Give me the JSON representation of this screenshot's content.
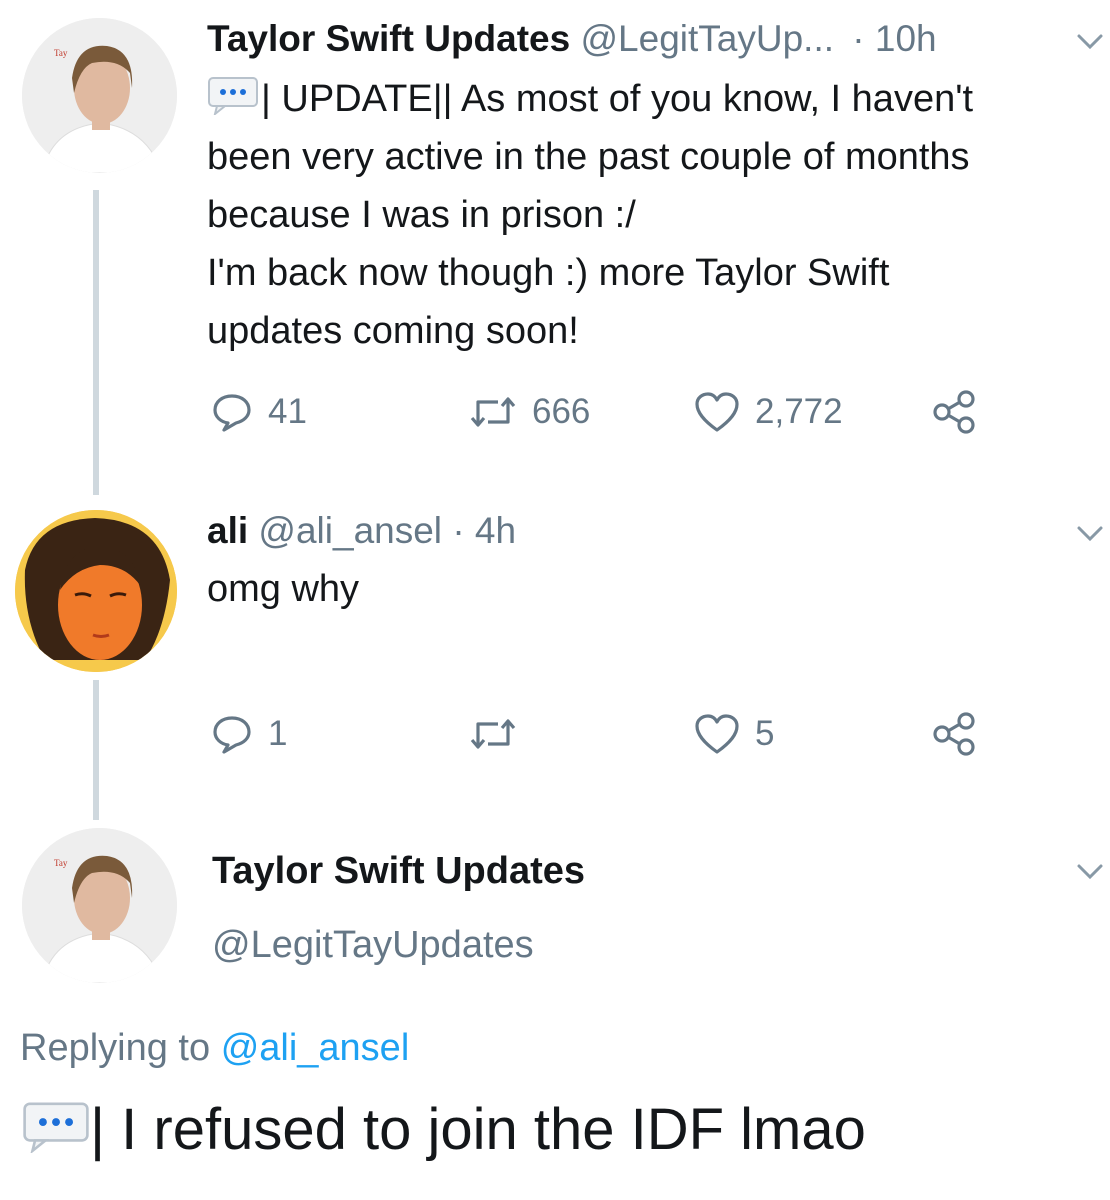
{
  "tweet1": {
    "name": "Taylor Swift Updates",
    "handle": "@LegitTayUp...",
    "time": "· 10h",
    "lines": [
      "| UPDATE|| As most of you know, I haven't",
      "been very active in the past couple of months",
      "because I was in prison :/",
      "I'm back now though :) more Taylor Swift",
      "updates coming soon!"
    ],
    "replies": "41",
    "retweets": "666",
    "likes": "2,772"
  },
  "tweet2": {
    "name": "ali",
    "handle": "@ali_ansel",
    "time": "· 4h",
    "text": "omg why",
    "replies": "1",
    "retweets": "",
    "likes": "5"
  },
  "tweet3": {
    "name": "Taylor Swift Updates",
    "handle": "@LegitTayUpdates",
    "replying_prefix": "Replying to",
    "replying_to": "@ali_ansel",
    "text": "| I refused to join the IDF lmao"
  },
  "colors": {
    "text": "#14171a",
    "muted": "#657786",
    "link": "#1da1f2",
    "line": "#cfd8de"
  }
}
